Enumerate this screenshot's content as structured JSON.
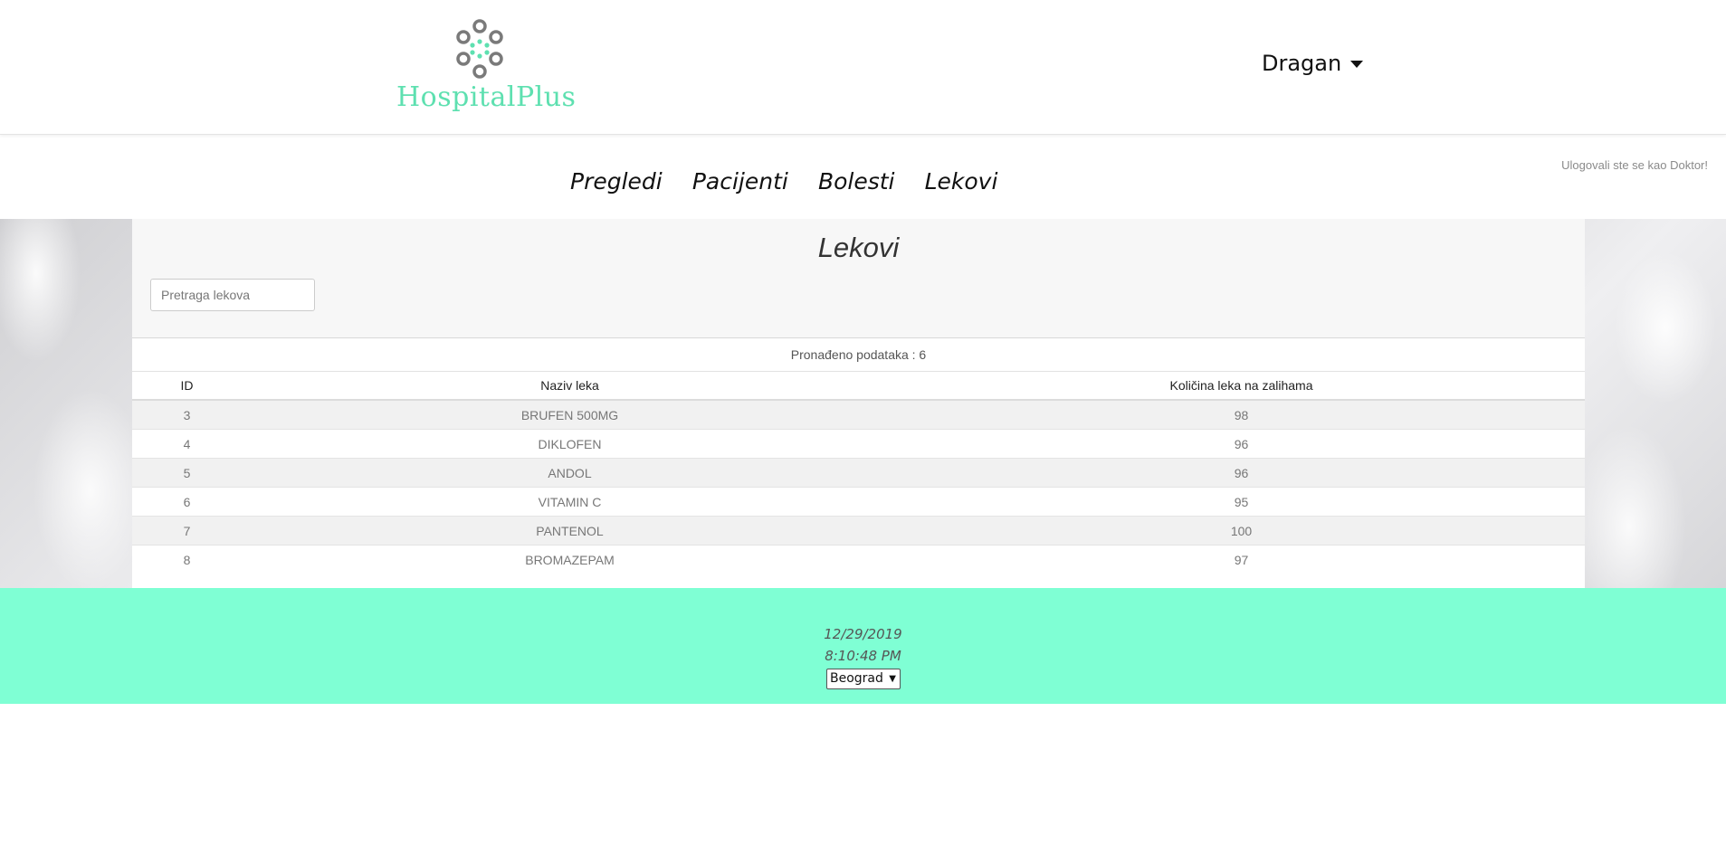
{
  "brand": {
    "name": "HospitalPlus"
  },
  "user": {
    "name": "Dragan"
  },
  "nav": {
    "items": [
      "Pregledi",
      "Pacijenti",
      "Bolesti",
      "Lekovi"
    ]
  },
  "login_note": "Ulogovali ste se kao Doktor!",
  "page": {
    "title": "Lekovi",
    "search_placeholder": "Pretraga lekova",
    "result_count": "Pronađeno podataka : 6"
  },
  "table": {
    "headers": [
      "ID",
      "Naziv leka",
      "Količina leka na zalihama"
    ],
    "rows": [
      [
        "3",
        "BRUFEN 500MG",
        "98"
      ],
      [
        "4",
        "DIKLOFEN",
        "96"
      ],
      [
        "5",
        "ANDOL",
        "96"
      ],
      [
        "6",
        "VITAMIN C",
        "95"
      ],
      [
        "7",
        "PANTENOL",
        "100"
      ],
      [
        "8",
        "BROMAZEPAM",
        "97"
      ]
    ]
  },
  "footer": {
    "date": "12/29/2019",
    "time": "8:10:48 PM",
    "city": "Beograd"
  },
  "colors": {
    "accent": "#7fffd4",
    "brand": "#5ee0b0",
    "logo_gray": "#7a7a7a"
  },
  "icons": {
    "logo": "molecule-ring-icon",
    "user_dropdown": "caret-down-icon",
    "city_dropdown": "caret-down-icon"
  }
}
